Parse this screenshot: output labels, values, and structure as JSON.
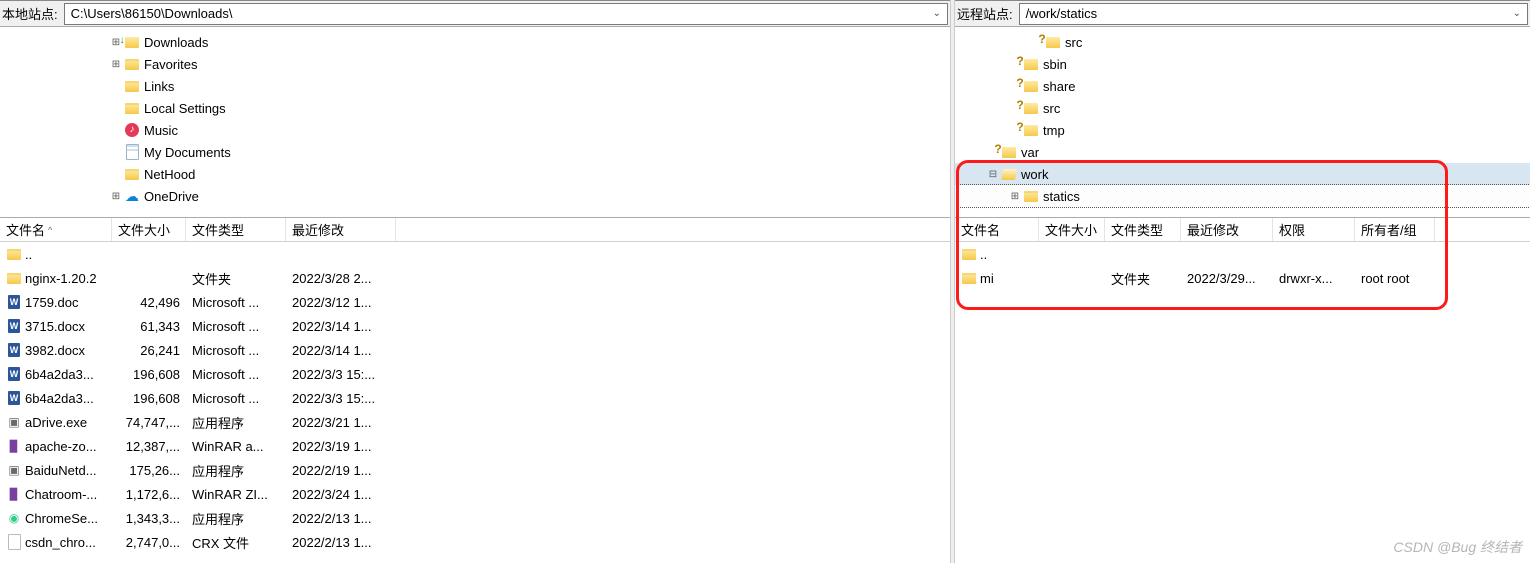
{
  "local": {
    "label": "本地站点:",
    "path": "C:\\Users\\86150\\Downloads\\",
    "tree": [
      {
        "indent": 110,
        "exp": "⊞",
        "icon": "folder-down",
        "label": "Downloads"
      },
      {
        "indent": 110,
        "exp": "⊞",
        "icon": "folder-icon",
        "label": "Favorites"
      },
      {
        "indent": 110,
        "exp": "",
        "icon": "folder-icon",
        "label": "Links"
      },
      {
        "indent": 110,
        "exp": "",
        "icon": "folder-icon",
        "label": "Local Settings"
      },
      {
        "indent": 110,
        "exp": "",
        "icon": "music-icon",
        "label": "Music"
      },
      {
        "indent": 110,
        "exp": "",
        "icon": "doc-icon",
        "label": "My Documents"
      },
      {
        "indent": 110,
        "exp": "",
        "icon": "folder-icon",
        "label": "NetHood"
      },
      {
        "indent": 110,
        "exp": "⊞",
        "icon": "onedrive-icon",
        "label": "OneDrive"
      }
    ],
    "headers": {
      "name": "文件名",
      "size": "文件大小",
      "type": "文件类型",
      "date": "最近修改"
    },
    "rows": [
      {
        "icon": "folder-icon",
        "name": "..",
        "size": "",
        "type": "",
        "date": ""
      },
      {
        "icon": "folder-icon",
        "name": "nginx-1.20.2",
        "size": "",
        "type": "文件夹",
        "date": "2022/3/28 2..."
      },
      {
        "icon": "word-icon",
        "name": "1759.doc",
        "size": "42,496",
        "type": "Microsoft ...",
        "date": "2022/3/12 1..."
      },
      {
        "icon": "word-icon",
        "name": "3715.docx",
        "size": "61,343",
        "type": "Microsoft ...",
        "date": "2022/3/14 1..."
      },
      {
        "icon": "word-icon",
        "name": "3982.docx",
        "size": "26,241",
        "type": "Microsoft ...",
        "date": "2022/3/14 1..."
      },
      {
        "icon": "word-icon",
        "name": "6b4a2da3...",
        "size": "196,608",
        "type": "Microsoft ...",
        "date": "2022/3/3 15:..."
      },
      {
        "icon": "word-icon",
        "name": "6b4a2da3...",
        "size": "196,608",
        "type": "Microsoft ...",
        "date": "2022/3/3 15:..."
      },
      {
        "icon": "exe-icon",
        "name": "aDrive.exe",
        "size": "74,747,...",
        "type": "应用程序",
        "date": "2022/3/21 1..."
      },
      {
        "icon": "rar-icon",
        "name": "apache-zo...",
        "size": "12,387,...",
        "type": "WinRAR a...",
        "date": "2022/3/19 1..."
      },
      {
        "icon": "exe-icon",
        "name": "BaiduNetd...",
        "size": "175,26...",
        "type": "应用程序",
        "date": "2022/2/19 1..."
      },
      {
        "icon": "rar-icon",
        "name": "Chatroom-...",
        "size": "1,172,6...",
        "type": "WinRAR ZI...",
        "date": "2022/3/24 1..."
      },
      {
        "icon": "chrome-icon",
        "name": "ChromeSe...",
        "size": "1,343,3...",
        "type": "应用程序",
        "date": "2022/2/13 1..."
      },
      {
        "icon": "generic-icon",
        "name": "csdn_chro...",
        "size": "2,747,0...",
        "type": "CRX 文件",
        "date": "2022/2/13 1..."
      }
    ]
  },
  "remote": {
    "label": "远程站点:",
    "path": "/work/statics",
    "tree": [
      {
        "indent": 76,
        "exp": "",
        "icon": "folder-q",
        "label": "src"
      },
      {
        "indent": 54,
        "exp": "",
        "icon": "folder-q",
        "label": "sbin"
      },
      {
        "indent": 54,
        "exp": "",
        "icon": "folder-q",
        "label": "share"
      },
      {
        "indent": 54,
        "exp": "",
        "icon": "folder-q",
        "label": "src"
      },
      {
        "indent": 54,
        "exp": "",
        "icon": "folder-q",
        "label": "tmp"
      },
      {
        "indent": 32,
        "exp": "",
        "icon": "folder-q",
        "label": "var"
      },
      {
        "indent": 32,
        "exp": "⊟",
        "icon": "folder-open",
        "label": "work",
        "sel": true
      },
      {
        "indent": 54,
        "exp": "⊞",
        "icon": "folder-icon",
        "label": "statics",
        "selbox": true
      }
    ],
    "headers": {
      "name": "文件名",
      "size": "文件大小",
      "type": "文件类型",
      "date": "最近修改",
      "perm": "权限",
      "owner": "所有者/组"
    },
    "rows": [
      {
        "icon": "folder-icon",
        "name": "..",
        "size": "",
        "type": "",
        "date": "",
        "perm": "",
        "owner": ""
      },
      {
        "icon": "folder-icon",
        "name": "mi",
        "size": "",
        "type": "文件夹",
        "date": "2022/3/29...",
        "perm": "drwxr-x...",
        "owner": "root root"
      }
    ]
  },
  "watermark": "CSDN @Bug 终结者"
}
